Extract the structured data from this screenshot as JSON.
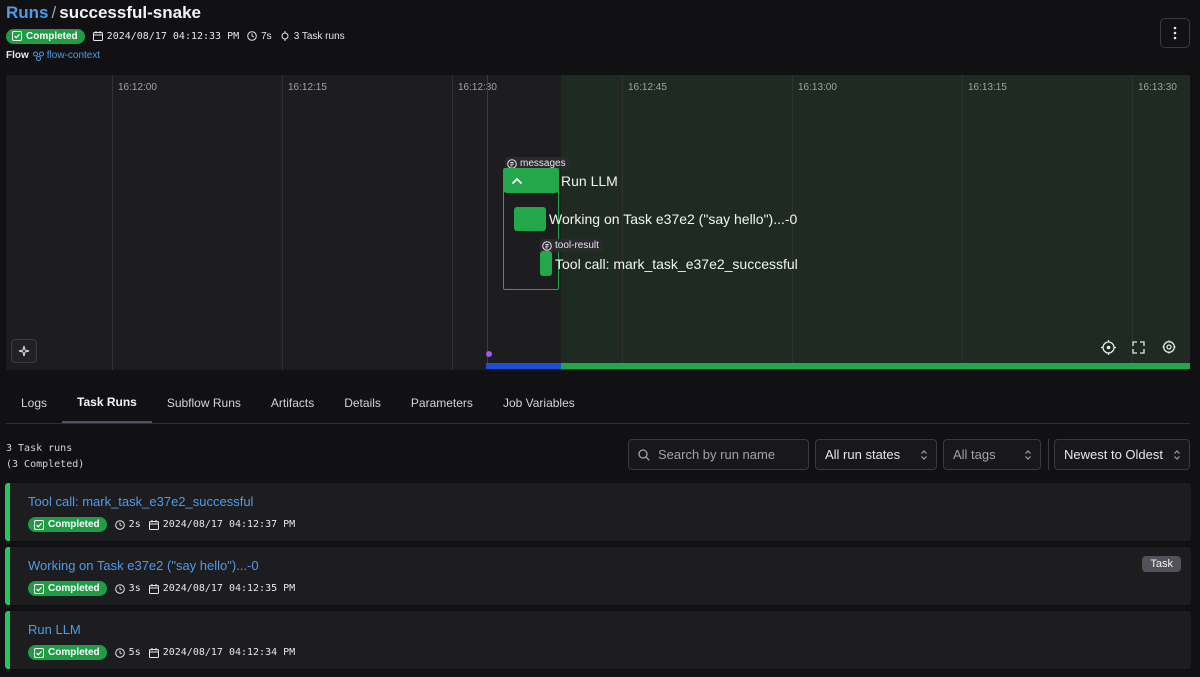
{
  "header": {
    "breadcrumb_root": "Runs",
    "breadcrumb_sep": "/",
    "run_name": "successful-snake",
    "state": "Completed",
    "start_time": "2024/08/17 04:12:33 PM",
    "duration": "7s",
    "task_runs": "3 Task runs",
    "flow_label": "Flow",
    "flow_name": "flow-context"
  },
  "timeline": {
    "ticks": [
      "16:12:00",
      "16:12:15",
      "16:12:30",
      "16:12:45",
      "16:13:00",
      "16:13:15",
      "16:13:30"
    ],
    "nodes": {
      "parent_label": "Run LLM",
      "child1_label": "Working on Task e37e2 (\"say hello\")...-0",
      "child2_label": "Tool call: mark_task_e37e2_successful",
      "artifact1": "messages",
      "artifact2": "tool-result"
    }
  },
  "tabs": [
    "Logs",
    "Task Runs",
    "Subflow Runs",
    "Artifacts",
    "Details",
    "Parameters",
    "Job Variables"
  ],
  "filters": {
    "count": "3 Task runs",
    "count_sub": "(3 Completed)",
    "search_placeholder": "Search by run name",
    "state_filter": "All run states",
    "tag_filter": "All tags",
    "sort": "Newest to Oldest"
  },
  "task_runs": [
    {
      "name": "Tool call: mark_task_e37e2_successful",
      "state": "Completed",
      "duration": "2s",
      "time": "2024/08/17 04:12:37 PM",
      "tag": ""
    },
    {
      "name": "Working on Task e37e2 (\"say hello\")...-0",
      "state": "Completed",
      "duration": "3s",
      "time": "2024/08/17 04:12:35 PM",
      "tag": "Task"
    },
    {
      "name": "Run LLM",
      "state": "Completed",
      "duration": "5s",
      "time": "2024/08/17 04:12:34 PM",
      "tag": ""
    }
  ],
  "colors": {
    "completed": "#1f9d45",
    "link": "#4f9be8",
    "accent_border": "#22c55e"
  }
}
